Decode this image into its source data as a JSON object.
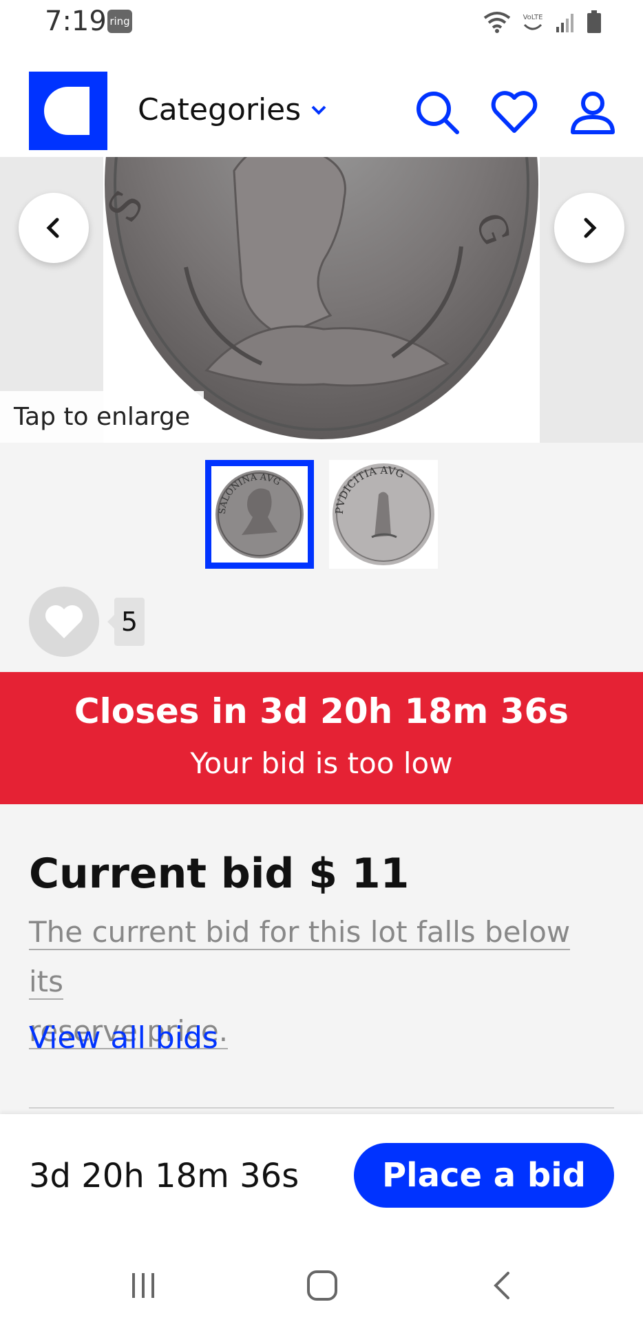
{
  "status_bar": {
    "time": "7:19",
    "ring_badge": "ring",
    "volte": "VoLTE",
    "icons": [
      "wifi-icon",
      "volte-icon",
      "signal-icon",
      "battery-icon"
    ]
  },
  "header": {
    "categories_label": "Categories",
    "icons": [
      "search-icon",
      "heart-icon",
      "user-icon"
    ],
    "accent_color": "#0033ff"
  },
  "gallery": {
    "tap_label": "Tap to enlarge",
    "coin_legend_front": "SALONINA AVG",
    "coin_legend_back": "PVDICITIA AVG",
    "thumbnails": [
      {
        "name": "obverse",
        "active": true
      },
      {
        "name": "reverse",
        "active": false
      }
    ]
  },
  "favorites": {
    "count": "5"
  },
  "closing": {
    "title": "Closes in 3d 20h 18m 36s",
    "subtitle": "Your bid is too low",
    "color": "#e52234"
  },
  "bid": {
    "current_bid": "Current bid $ 11",
    "reserve_line1": "The current bid for this lot falls below its",
    "reserve_line2": "reserve price.",
    "view_all": "View all bids"
  },
  "bid_bar": {
    "timer": "3d 20h 18m 36s",
    "button_label": "Place a bid"
  },
  "system_nav": [
    "recents-icon",
    "home-icon",
    "back-icon"
  ]
}
